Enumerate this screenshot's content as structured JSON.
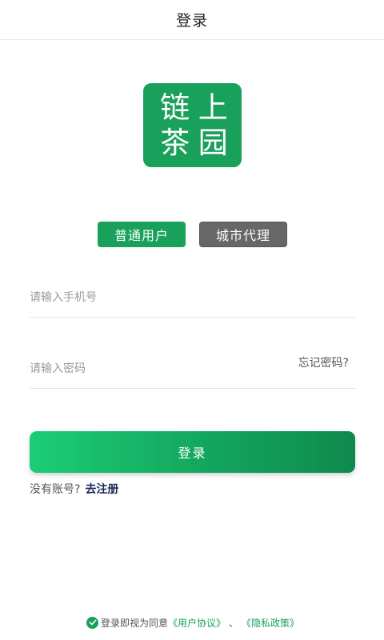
{
  "header": {
    "title": "登录"
  },
  "logo": {
    "chars": [
      "链",
      "上",
      "茶",
      "园"
    ]
  },
  "roles": {
    "normal_label": "普通用户",
    "agent_label": "城市代理"
  },
  "phone": {
    "placeholder": "请输入手机号",
    "value": ""
  },
  "password": {
    "placeholder": "请输入密码",
    "value": "",
    "forgot_label": "忘记密码?"
  },
  "login": {
    "label": "登录"
  },
  "register": {
    "question": "没有账号?",
    "link_label": "去注册"
  },
  "agreement": {
    "prefix": "登录即视为同意",
    "user_agreement": "《用户协议》",
    "separator": "、",
    "privacy_policy": "《隐私政策》",
    "checked": true
  },
  "colors": {
    "brand": "#19a05a",
    "agent_button": "#676767",
    "link": "#1b2a55"
  }
}
